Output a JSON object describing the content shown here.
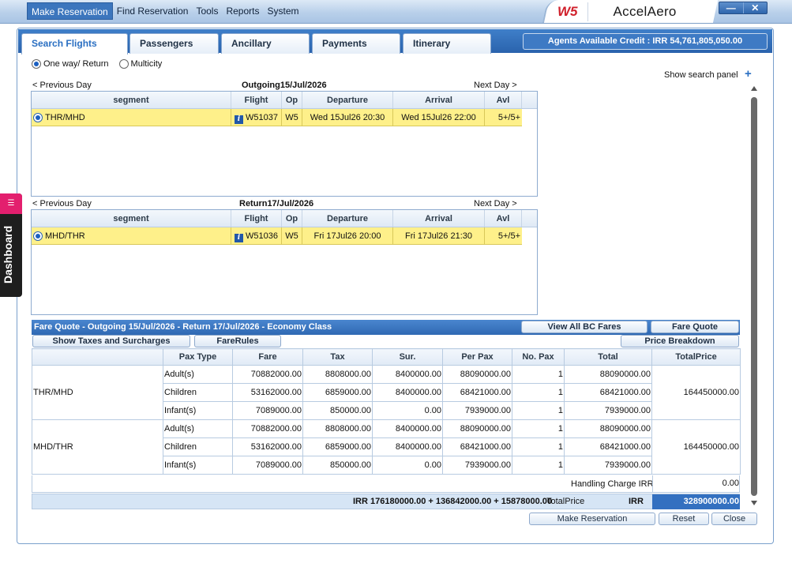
{
  "menu": [
    "Make Reservation",
    "Find Reservation",
    "Tools",
    "Reports",
    "System"
  ],
  "brand": {
    "code": "W5",
    "name": "AccelAero"
  },
  "window": {
    "minimize": "—",
    "close": "✕"
  },
  "tabs": [
    "Search Flights",
    "Passengers",
    "Ancillary",
    "Payments",
    "Itinerary"
  ],
  "credit": "Agents Available Credit : IRR 54,761,805,050.00",
  "trip": {
    "oneway": "One way/ Return",
    "multicity": "Multicity"
  },
  "search_panel": {
    "label": "Show search panel",
    "plus": "+"
  },
  "outgoing": {
    "prev": "< Previous Day",
    "title": "Outgoing15/Jul/2026",
    "next": "Next Day >",
    "headers": [
      "segment",
      "Flight",
      "Op",
      "Departure",
      "Arrival",
      "Avl"
    ],
    "row": {
      "segment": "THR/MHD",
      "flight": "W51037",
      "op": "W5",
      "departure": "Wed 15Jul26 20:30",
      "arrival": "Wed 15Jul26 22:00",
      "avl": "5+/5+"
    }
  },
  "return": {
    "prev": "< Previous Day",
    "title": "Return17/Jul/2026",
    "next": "Next Day >",
    "headers": [
      "segment",
      "Flight",
      "Op",
      "Departure",
      "Arrival",
      "Avl"
    ],
    "row": {
      "segment": "MHD/THR",
      "flight": "W51036",
      "op": "W5",
      "departure": "Fri 17Jul26 20:00",
      "arrival": "Fri 17Jul26 21:30",
      "avl": "5+/5+"
    }
  },
  "fare": {
    "title": "Fare Quote - Outgoing 15/Jul/2026 - Return 17/Jul/2026 - Economy Class",
    "view_all": "View All BC Fares",
    "fare_quote": "Fare Quote",
    "show_taxes": "Show Taxes and Surcharges",
    "fare_rules": "FareRules",
    "price_breakdown": "Price Breakdown",
    "headers": [
      "Pax Type",
      "Fare",
      "Tax",
      "Sur.",
      "Per Pax",
      "No. Pax",
      "Total",
      "TotalPrice"
    ],
    "segments": [
      {
        "name": "THR/MHD",
        "total_price": "164450000.00",
        "rows": [
          {
            "pax": "Adult(s)",
            "fare": "70882000.00",
            "tax": "8808000.00",
            "sur": "8400000.00",
            "per_pax": "88090000.00",
            "no_pax": "1",
            "total": "88090000.00"
          },
          {
            "pax": "Children",
            "fare": "53162000.00",
            "tax": "6859000.00",
            "sur": "8400000.00",
            "per_pax": "68421000.00",
            "no_pax": "1",
            "total": "68421000.00"
          },
          {
            "pax": "Infant(s)",
            "fare": "7089000.00",
            "tax": "850000.00",
            "sur": "0.00",
            "per_pax": "7939000.00",
            "no_pax": "1",
            "total": "7939000.00"
          }
        ]
      },
      {
        "name": "MHD/THR",
        "total_price": "164450000.00",
        "rows": [
          {
            "pax": "Adult(s)",
            "fare": "70882000.00",
            "tax": "8808000.00",
            "sur": "8400000.00",
            "per_pax": "88090000.00",
            "no_pax": "1",
            "total": "88090000.00"
          },
          {
            "pax": "Children",
            "fare": "53162000.00",
            "tax": "6859000.00",
            "sur": "8400000.00",
            "per_pax": "68421000.00",
            "no_pax": "1",
            "total": "68421000.00"
          },
          {
            "pax": "Infant(s)",
            "fare": "7089000.00",
            "tax": "850000.00",
            "sur": "0.00",
            "per_pax": "7939000.00",
            "no_pax": "1",
            "total": "7939000.00"
          }
        ]
      }
    ],
    "handling_label": "Handling Charge IRR",
    "handling_value": "0.00",
    "total_breakdown": "IRR 176180000.00 + 136842000.00 + 15878000.00",
    "total_label": "TotalPrice",
    "currency": "IRR",
    "grand_total": "328900000.00"
  },
  "actions": {
    "make_reservation": "Make Reservation",
    "reset": "Reset",
    "close": "Close"
  },
  "dashboard": "Dashboard",
  "colors": {
    "accent": "#2f69b3",
    "selected_row": "#fef08a",
    "brand_red": "#d0202b",
    "dashboard_pink": "#e31f6e"
  }
}
